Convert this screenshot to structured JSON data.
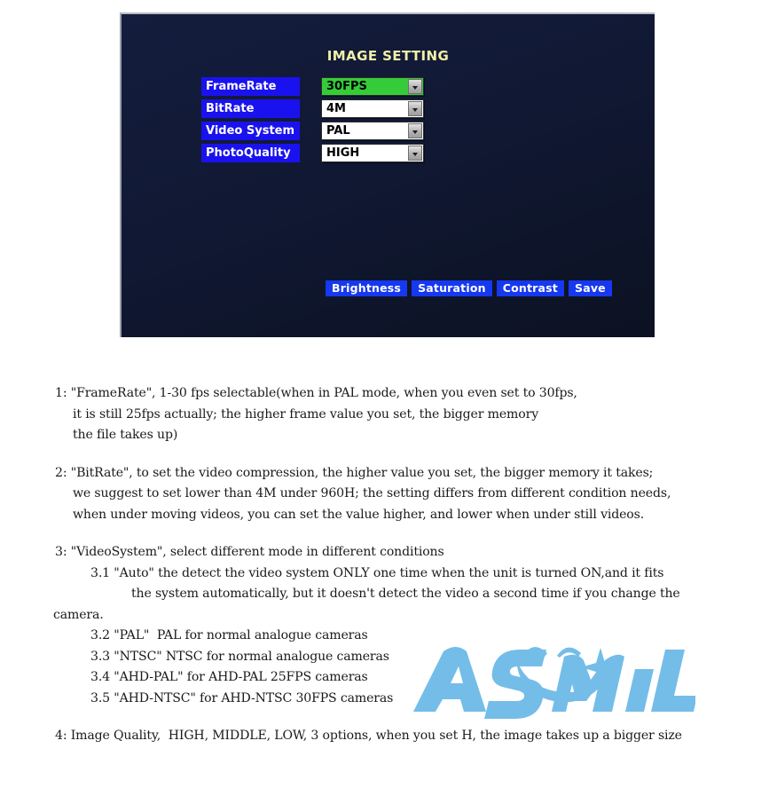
{
  "osd": {
    "title": "IMAGE SETTING",
    "accent_blue": "#1a12ee",
    "selected_green": "#35cc3a",
    "title_yellow": "#f2f0a8",
    "panel_navy": "#101833",
    "rows": [
      {
        "label": "FrameRate",
        "value": "30FPS",
        "selected": true,
        "arrow_icon": "chevron-down-icon"
      },
      {
        "label": "BitRate",
        "value": "4M",
        "selected": false,
        "arrow_icon": "chevron-down-icon"
      },
      {
        "label": "Video System",
        "value": "PAL",
        "selected": false,
        "arrow_icon": "chevron-down-icon"
      },
      {
        "label": "PhotoQuality",
        "value": "HIGH",
        "selected": false,
        "arrow_icon": "chevron-down-icon"
      }
    ],
    "buttons": [
      {
        "label": "Brightness"
      },
      {
        "label": "Saturation"
      },
      {
        "label": "Contrast"
      },
      {
        "label": "Save"
      }
    ]
  },
  "notes": {
    "item1": {
      "l1": "1: \"FrameRate\", 1-30 fps selectable(when in PAL mode, when you even set to 30fps,",
      "l2": "it is still 25fps actually; the higher frame value you set, the bigger memory",
      "l3": "the file takes up)"
    },
    "item2": {
      "l1": "2: \"BitRate\", to set the video compression, the higher value you set, the bigger memory it takes;",
      "l2": "we suggest to set lower than 4M under 960H; the setting differs from different condition needs,",
      "l3": "when under moving videos, you can set the value higher, and lower when under still videos."
    },
    "item3": {
      "l1": "3: \"VideoSystem\", select different mode in different conditions",
      "l2": "3.1 \"Auto\" the detect the video system ONLY one time when the unit is turned ON,and it fits",
      "l3": "the system automatically, but it doesn't detect the video a second time if you change the",
      "l4": "camera.",
      "l5": "3.2 \"PAL\"  PAL for normal analogue cameras",
      "l6": "3.3 \"NTSC\" NTSC for normal analogue cameras",
      "l7": "3.4 \"AHD-PAL\" for AHD-PAL 25FPS cameras",
      "l8": "3.5 \"AHD-NTSC\" for AHD-NTSC 30FPS cameras"
    },
    "item4": {
      "l1": "4: Image Quality,  HIGH, MIDDLE, LOW, 3 options, when you set H, the image takes up a bigger size"
    }
  },
  "watermark": {
    "brand": "ASMILE",
    "color": "#74bde8",
    "icon": "smile-face-logo"
  }
}
